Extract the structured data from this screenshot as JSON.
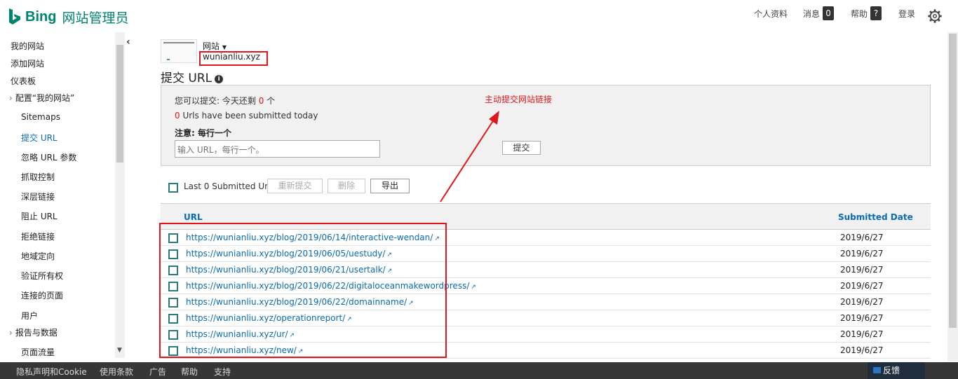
{
  "header": {
    "logo_text": "Bing",
    "product_name": "网站管理员",
    "nav": {
      "profile": "个人资料",
      "messages": "消息",
      "messages_count": "0",
      "help": "帮助",
      "help_badge": "?",
      "login": "登录"
    }
  },
  "sidebar": {
    "items": [
      {
        "label": "我的网站"
      },
      {
        "label": "添加网站"
      },
      {
        "label": "仪表板"
      },
      {
        "label": "配置“我的网站”"
      },
      {
        "label": "Sitemaps"
      },
      {
        "label": "提交 URL"
      },
      {
        "label": "忽略 URL 参数"
      },
      {
        "label": "抓取控制"
      },
      {
        "label": "深层链接"
      },
      {
        "label": "阻止 URL"
      },
      {
        "label": "拒绝链接"
      },
      {
        "label": "地域定向"
      },
      {
        "label": "验证所有权"
      },
      {
        "label": "连接的页面"
      },
      {
        "label": "用户"
      },
      {
        "label": "报告与数据"
      },
      {
        "label": "页面流量"
      }
    ]
  },
  "site": {
    "label": "网站",
    "domain": "wunianliu.xyz"
  },
  "page": {
    "title": "提交 URL",
    "quota_prefix": "您可以提交: 今天还剩",
    "quota_count": "0",
    "quota_suffix": "个",
    "submitted_count": "0",
    "submitted_text": "Urls have been submitted today",
    "note": "注意: 每行一个",
    "input_placeholder": "输入 URL，每行一个。",
    "submit_label": "提交",
    "annotation": "主动提交网站链接"
  },
  "toolbar": {
    "last_submitted_label": "Last 0 Submitted Urls",
    "resubmit_label": "重新提交",
    "delete_label": "删除",
    "export_label": "导出"
  },
  "table": {
    "columns": [
      "URL",
      "Submitted Date"
    ],
    "rows": [
      {
        "url": "https://wunianliu.xyz/blog/2019/06/14/interactive-wendan/",
        "date": "2019/6/27"
      },
      {
        "url": "https://wunianliu.xyz/blog/2019/06/05/uestudy/",
        "date": "2019/6/27"
      },
      {
        "url": "https://wunianliu.xyz/blog/2019/06/21/usertalk/",
        "date": "2019/6/27"
      },
      {
        "url": "https://wunianliu.xyz/blog/2019/06/22/digitaloceanmakewordpress/",
        "date": "2019/6/27"
      },
      {
        "url": "https://wunianliu.xyz/blog/2019/06/22/domainname/",
        "date": "2019/6/27"
      },
      {
        "url": "https://wunianliu.xyz/operationreport/",
        "date": "2019/6/27"
      },
      {
        "url": "https://wunianliu.xyz/ur/",
        "date": "2019/6/27"
      },
      {
        "url": "https://wunianliu.xyz/new/",
        "date": "2019/6/27"
      }
    ]
  },
  "footer": {
    "links": [
      "隐私声明和Cookie",
      "使用条款",
      "广告",
      "帮助",
      "支持"
    ],
    "feedback": "反馈"
  },
  "colors": {
    "brand": "#008373",
    "link": "#0a6bb3",
    "highlight": "#e0161b"
  }
}
